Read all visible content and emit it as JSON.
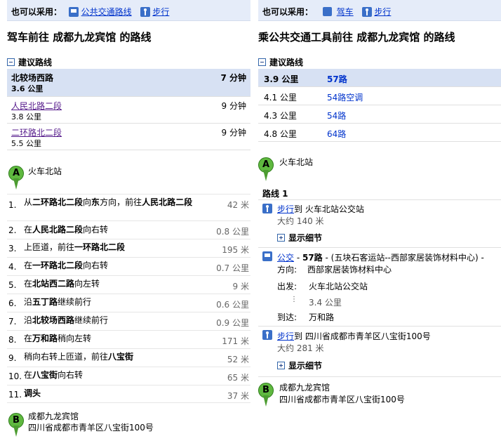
{
  "left": {
    "also_use_label": "也可以采用：",
    "alt1": "公共交通路线",
    "alt2": "步行",
    "title": "驾车前往  成都九龙宾馆  的路线",
    "suggest_label": "建议路线",
    "routes": [
      {
        "name": "北较场西路",
        "dist": "3.6 公里",
        "time": "7 分钟"
      },
      {
        "name": "人民北路二段",
        "dist": "3.8 公里",
        "time": "9 分钟"
      },
      {
        "name": "二环路北二段",
        "dist": "5.5 公里",
        "time": "9 分钟"
      }
    ],
    "start": "火车北站",
    "start_marker": "A",
    "steps": [
      {
        "n": "1.",
        "d": "42 米"
      },
      {
        "n": "2.",
        "d": "0.8 公里"
      },
      {
        "n": "3.",
        "d": "195 米"
      },
      {
        "n": "4.",
        "d": "0.7 公里"
      },
      {
        "n": "5.",
        "d": "9 米"
      },
      {
        "n": "6.",
        "d": "0.6 公里"
      },
      {
        "n": "7.",
        "d": "0.9 公里"
      },
      {
        "n": "8.",
        "d": "171 米"
      },
      {
        "n": "9.",
        "d": "52 米"
      },
      {
        "n": "10.",
        "d": "65 米"
      },
      {
        "n": "11.",
        "d": "37 米"
      }
    ],
    "step_text": {
      "s1a": "从",
      "s1b": "二环路北二段",
      "s1c": "向",
      "s1d": "东",
      "s1e": "方向，前往",
      "s1f": "人民北路二段",
      "s2a": "在",
      "s2b": "人民北路二段",
      "s2c": "向右转",
      "s3a": "上匝道，前往",
      "s3b": "一环路北二段",
      "s4a": "在",
      "s4b": "一环路北二段",
      "s4c": "向右转",
      "s5a": "在",
      "s5b": "北站西二路",
      "s5c": "向左转",
      "s6a": "沿",
      "s6b": "五丁路",
      "s6c": "继续前行",
      "s7a": "沿",
      "s7b": "北较场西路",
      "s7c": "继续前行",
      "s8a": "在",
      "s8b": "万和路",
      "s8c": "稍向左转",
      "s9a": "稍向右转上匝道，前往",
      "s9b": "八宝街",
      "s10a": "在",
      "s10b": "八宝街",
      "s10c": "向右转",
      "s11": "调头"
    },
    "end_marker": "B",
    "end_name": "成都九龙宾馆",
    "end_addr": "四川省成都市青羊区八宝街100号"
  },
  "right": {
    "also_use_label": "也可以采用：",
    "alt1": "驾车",
    "alt2": "步行",
    "title": "乘公共交通工具前往  成都九龙宾馆  的路线",
    "suggest_label": "建议路线",
    "routes": [
      {
        "dist": "3.9 公里",
        "line": "57路"
      },
      {
        "dist": "4.1 公里",
        "line": "54路空调"
      },
      {
        "dist": "4.3 公里",
        "line": "54路"
      },
      {
        "dist": "4.8 公里",
        "line": "64路"
      }
    ],
    "start": "火车北站",
    "start_marker": "A",
    "route_label": "路线  1",
    "walk1_link": "步行",
    "walk1_to": "到  火车北站公交站",
    "walk1_about": "大约  140 米",
    "show_detail": "显示细节",
    "bus_link": "公交",
    "bus_line": "57路",
    "bus_desc": "- (五块石客运站--西部家居装饰材料中心) -",
    "direction_label": "方向:",
    "direction": "西部家居装饰材料中心",
    "depart_label": "出发:",
    "depart": "火车北站公交站",
    "ride_dist": "3.4 公里",
    "arrive_label": "到达:",
    "arrive": "万和路",
    "walk2_link": "步行",
    "walk2_to": "到  四川省成都市青羊区八宝街100号",
    "walk2_about": "大约  281 米",
    "end_marker": "B",
    "end_name": "成都九龙宾馆",
    "end_addr": "四川省成都市青羊区八宝街100号"
  },
  "icons": {
    "transit": "bus-icon",
    "walk": "walk-icon",
    "car": "car-icon",
    "collapse": "minus-box-icon",
    "expand": "plus-box-icon",
    "marker": "map-pin-icon"
  },
  "colors": {
    "link": "#0033cc",
    "selected_row": "#d7e1f3",
    "header_bar": "#e5ecf9",
    "marker": "#5fb83f"
  }
}
